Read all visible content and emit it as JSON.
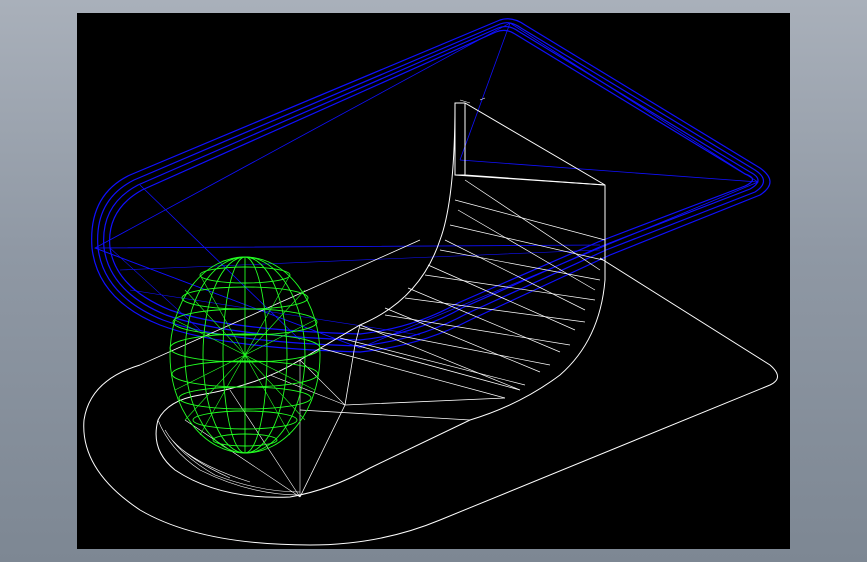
{
  "viewport": {
    "background": "#000000",
    "colors": {
      "upper_shell": "#1010ff",
      "pipe_and_base": "#ffffff",
      "sphere": "#22ff22"
    }
  },
  "objects": [
    {
      "name": "blue-shell-wireframe",
      "color": "#1010ff"
    },
    {
      "name": "white-curved-channel-wireframe",
      "color": "#ffffff"
    },
    {
      "name": "white-base-outline",
      "color": "#ffffff"
    },
    {
      "name": "green-ellipsoid-wireframe",
      "color": "#22ff22"
    }
  ]
}
